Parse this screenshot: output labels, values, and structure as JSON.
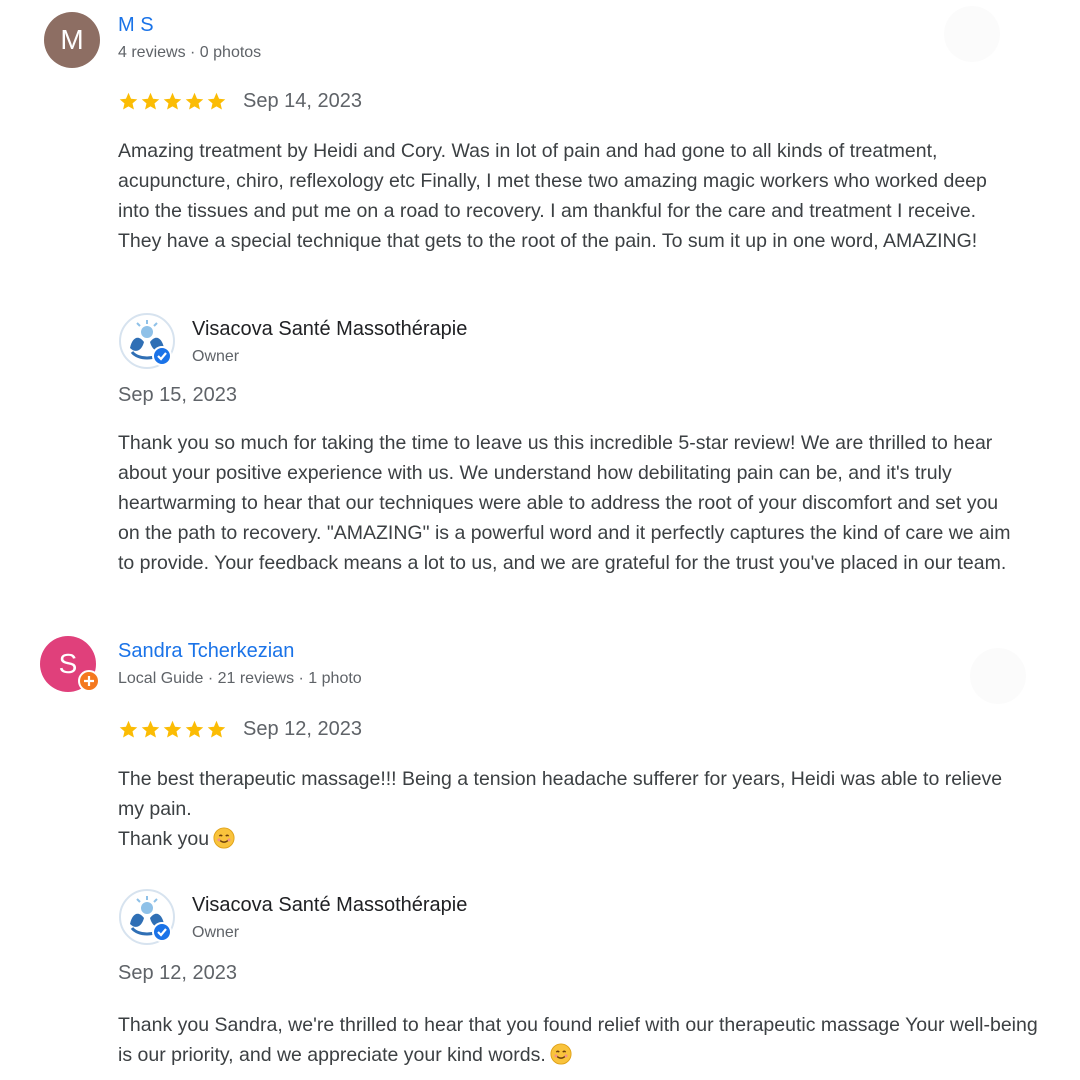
{
  "reviews": [
    {
      "avatar_letter": "M",
      "avatar_color": "#8d6e63",
      "local_guide": false,
      "name": "M S",
      "meta": "4 reviews · 0 photos",
      "rating": 5,
      "date": "Sep 14, 2023",
      "text": "Amazing treatment by Heidi and Cory. Was in lot of pain and had gone to all kinds of treatment, acupuncture, chiro, reflexology etc Finally, I met these two amazing magic workers who worked deep into the tissues and put me on a road to recovery. I am thankful for the care and treatment I receive. They have a special technique that gets to the root of the pain. To sum it up in one word, AMAZING!",
      "reply": {
        "owner_name": "Visacova Santé Massothérapie",
        "owner_role": "Owner",
        "date": "Sep 15, 2023",
        "text": "Thank you so much for taking the time to leave us this incredible 5-star review! We are thrilled to hear about your positive experience with us. We understand how debilitating pain can be, and it's truly heartwarming to hear that our techniques were able to address the root of your discomfort and set you on the path to recovery. \"AMAZING\" is a powerful word and it perfectly captures the kind of care we aim to provide. Your feedback means a lot to us, and we are grateful for the trust you've placed in our team."
      }
    },
    {
      "avatar_letter": "S",
      "avatar_color": "#e0407b",
      "local_guide": true,
      "name": "Sandra Tcherkezian",
      "meta": "Local Guide · 21 reviews · 1 photo",
      "rating": 5,
      "date": "Sep 12, 2023",
      "text": "The best therapeutic massage!!! Being a tension headache sufferer for years, Heidi was able to relieve my pain.\nThank you",
      "text_emoji": "smiling-face-icon",
      "reply": {
        "owner_name": "Visacova Santé Massothérapie",
        "owner_role": "Owner",
        "date": "Sep 12, 2023",
        "text": "Thank you Sandra, we're thrilled to hear that you found relief with our therapeutic massage Your well-being is our priority, and we appreciate your kind words.",
        "text_emoji": "smiling-face-icon"
      }
    }
  ],
  "colors": {
    "name_link": "#1a73e8",
    "star": "#fbbc04",
    "verified": "#1a73e8",
    "local_guide_badge": "#f4781f"
  }
}
